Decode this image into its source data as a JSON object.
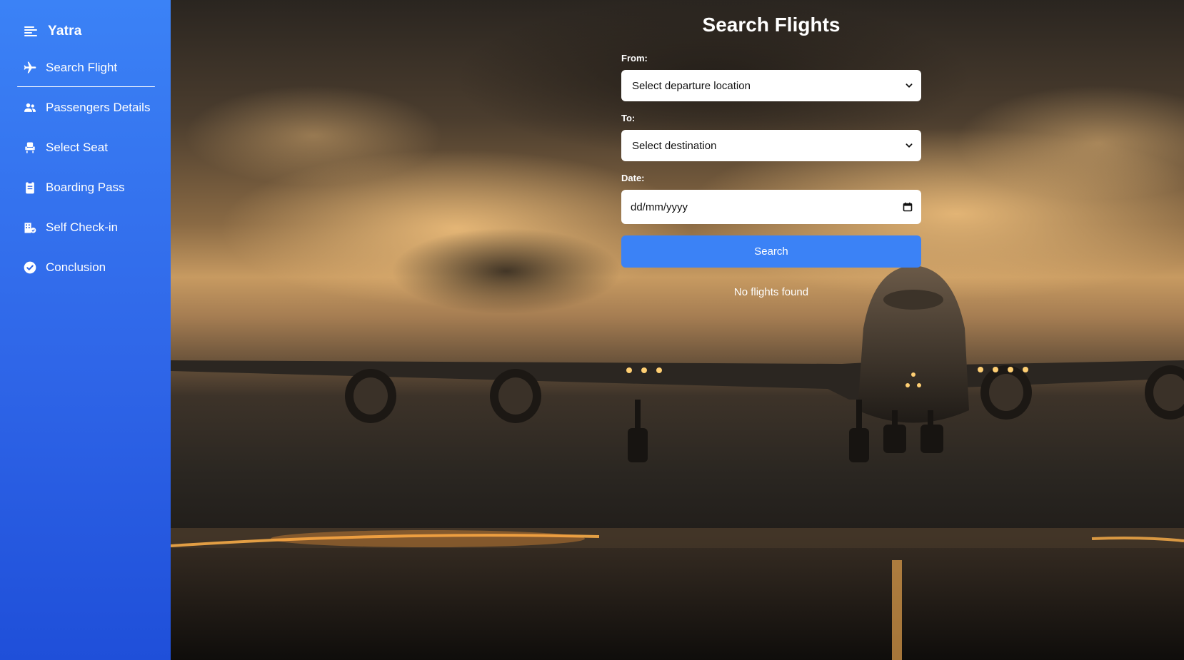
{
  "sidebar": {
    "brand": "Yatra",
    "items": [
      {
        "label": "Search Flight",
        "icon": "airplane-icon",
        "active": true
      },
      {
        "label": "Passengers Details",
        "icon": "users-icon",
        "active": false
      },
      {
        "label": "Select Seat",
        "icon": "seat-icon",
        "active": false
      },
      {
        "label": "Boarding Pass",
        "icon": "clipboard-icon",
        "active": false
      },
      {
        "label": "Self Check-in",
        "icon": "building-check-icon",
        "active": false
      },
      {
        "label": "Conclusion",
        "icon": "check-circle-icon",
        "active": false
      }
    ]
  },
  "form": {
    "title": "Search Flights",
    "from_label": "From:",
    "from_value": "Select departure location",
    "to_label": "To:",
    "to_value": "Select destination",
    "date_label": "Date:",
    "date_value": "dd/mm/yyyy",
    "search_label": "Search",
    "empty_message": "No flights found"
  },
  "colors": {
    "sidebar_top": "#3b82f6",
    "sidebar_bottom": "#1f4fd9",
    "button": "#3b82f6"
  }
}
